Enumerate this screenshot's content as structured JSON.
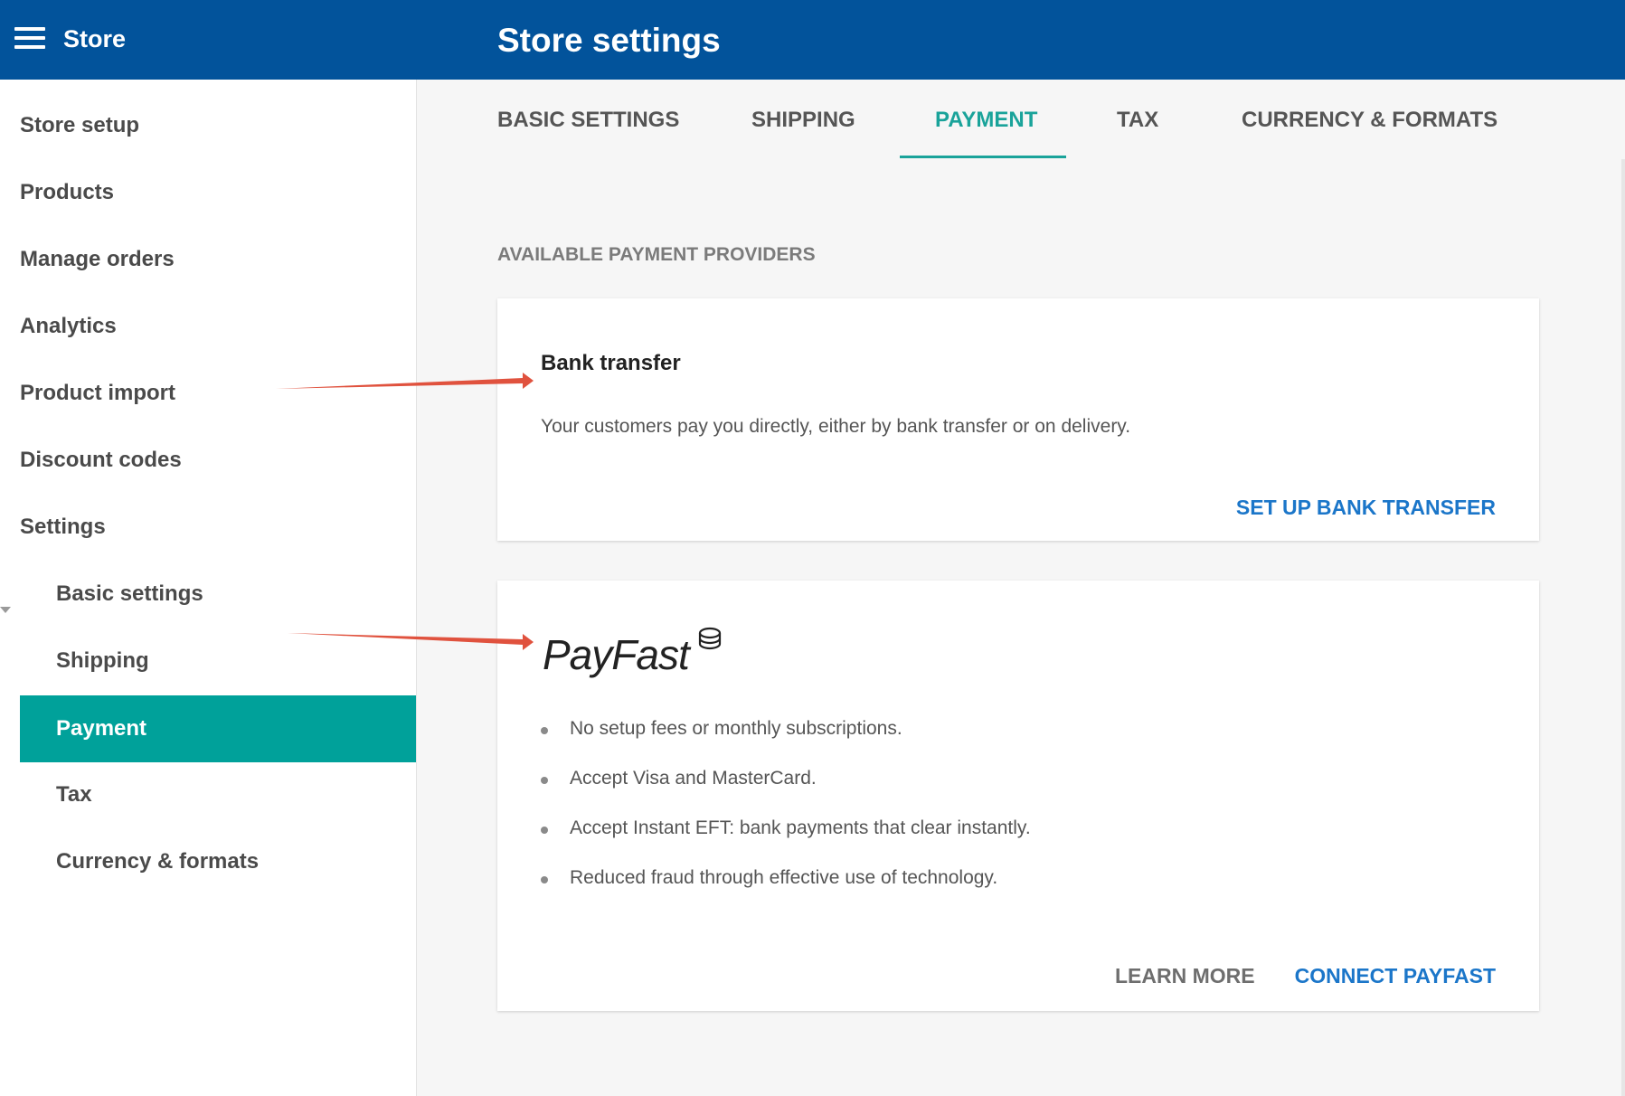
{
  "header": {
    "app_title": "Store",
    "page_title": "Store settings"
  },
  "sidebar": {
    "items": [
      "Store setup",
      "Products",
      "Manage orders",
      "Analytics",
      "Product import",
      "Discount codes",
      "Settings"
    ],
    "sub_items": [
      "Basic settings",
      "Shipping",
      "Payment",
      "Tax",
      "Currency & formats"
    ],
    "active": "Payment"
  },
  "tabs": [
    "BASIC SETTINGS",
    "SHIPPING",
    "PAYMENT",
    "TAX",
    "CURRENCY & FORMATS"
  ],
  "active_tab": "PAYMENT",
  "section_label": "AVAILABLE PAYMENT PROVIDERS",
  "bank_transfer": {
    "title": "Bank transfer",
    "description": "Your customers pay you directly, either by bank transfer or on delivery.",
    "action": "SET UP BANK TRANSFER"
  },
  "payfast": {
    "logo_text": "PayFast",
    "features": [
      "No setup fees or monthly subscriptions.",
      "Accept Visa and MasterCard.",
      "Accept Instant EFT: bank payments that clear instantly.",
      "Reduced fraud through effective use of technology."
    ],
    "learn_more": "LEARN MORE",
    "connect": "CONNECT PAYFAST"
  },
  "colors": {
    "header": "#02539b",
    "accent": "#00a19a",
    "link": "#1b76c9",
    "annotation_arrow": "#e0523e"
  }
}
